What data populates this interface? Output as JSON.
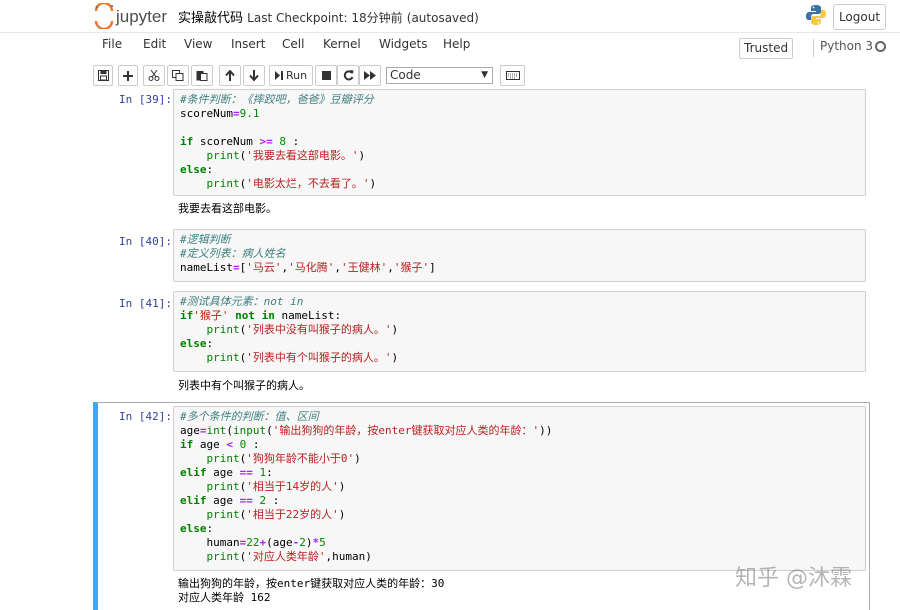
{
  "header": {
    "logo_text": "jupyter",
    "notebook_name": "实操敲代码",
    "checkpoint": "Last Checkpoint: 18分钟前",
    "autosave": "(autosaved)",
    "logout_label": "Logout"
  },
  "menu": {
    "items": [
      "File",
      "Edit",
      "View",
      "Insert",
      "Cell",
      "Kernel",
      "Widgets",
      "Help"
    ],
    "trusted_label": "Trusted",
    "kernel_name": "Python 3"
  },
  "toolbar": {
    "run_label": "Run",
    "cell_type": "Code"
  },
  "cells": [
    {
      "prompt": "In [39]:",
      "lines": [
        [
          [
            "cm-comment",
            "#条件判断：《摔跤吧，爸爸》豆瓣评分"
          ]
        ],
        [
          [
            "",
            "scoreNum"
          ],
          [
            "cm-operator",
            "="
          ],
          [
            "cm-number",
            "9.1"
          ]
        ],
        [
          [
            "",
            ""
          ]
        ],
        [
          [
            "cm-keyword",
            "if"
          ],
          [
            "",
            " scoreNum "
          ],
          [
            "cm-operator",
            ">="
          ],
          [
            "",
            " "
          ],
          [
            "cm-number",
            "8"
          ],
          [
            "",
            " :"
          ]
        ],
        [
          [
            "",
            "    "
          ],
          [
            "cm-builtin",
            "print"
          ],
          [
            "",
            "("
          ],
          [
            "cm-string",
            "'我要去看这部电影。'"
          ],
          [
            "",
            ")"
          ]
        ],
        [
          [
            "cm-keyword",
            "else"
          ],
          [
            "",
            ":"
          ]
        ],
        [
          [
            "",
            "    "
          ],
          [
            "cm-builtin",
            "print"
          ],
          [
            "",
            "("
          ],
          [
            "cm-string",
            "'电影太烂，不去看了。'"
          ],
          [
            "",
            ")"
          ]
        ]
      ],
      "output": [
        "我要去看这部电影。"
      ]
    },
    {
      "prompt": "In [40]:",
      "lines": [
        [
          [
            "cm-comment",
            "#逻辑判断"
          ]
        ],
        [
          [
            "cm-comment",
            "#定义列表：病人姓名"
          ]
        ],
        [
          [
            "",
            "nameList"
          ],
          [
            "cm-operator",
            "="
          ],
          [
            "",
            "["
          ],
          [
            "cm-string",
            "'马云'"
          ],
          [
            "",
            ","
          ],
          [
            "cm-string",
            "'马化腾'"
          ],
          [
            "",
            ","
          ],
          [
            "cm-string",
            "'王健林'"
          ],
          [
            "",
            ","
          ],
          [
            "cm-string",
            "'猴子'"
          ],
          [
            "",
            "]"
          ]
        ]
      ],
      "output": []
    },
    {
      "prompt": "In [41]:",
      "lines": [
        [
          [
            "cm-comment",
            "#测试具体元素：not in"
          ]
        ],
        [
          [
            "cm-keyword",
            "if"
          ],
          [
            "cm-string",
            "'猴子'"
          ],
          [
            "",
            " "
          ],
          [
            "cm-keyword",
            "not"
          ],
          [
            "",
            " "
          ],
          [
            "cm-keyword",
            "in"
          ],
          [
            "",
            " nameList:"
          ]
        ],
        [
          [
            "",
            "    "
          ],
          [
            "cm-builtin",
            "print"
          ],
          [
            "",
            "("
          ],
          [
            "cm-string",
            "'列表中没有叫猴子的病人。'"
          ],
          [
            "",
            ")"
          ]
        ],
        [
          [
            "cm-keyword",
            "else"
          ],
          [
            "",
            ":"
          ]
        ],
        [
          [
            "",
            "    "
          ],
          [
            "cm-builtin",
            "print"
          ],
          [
            "",
            "("
          ],
          [
            "cm-string",
            "'列表中有个叫猴子的病人。'"
          ],
          [
            "",
            ")"
          ]
        ]
      ],
      "output": [
        "列表中有个叫猴子的病人。"
      ]
    },
    {
      "prompt": "In [42]:",
      "lines": [
        [
          [
            "cm-comment",
            "#多个条件的判断：值、区间"
          ]
        ],
        [
          [
            "",
            "age"
          ],
          [
            "cm-operator",
            "="
          ],
          [
            "cm-builtin",
            "int"
          ],
          [
            "",
            "("
          ],
          [
            "cm-builtin",
            "input"
          ],
          [
            "",
            "("
          ],
          [
            "cm-string",
            "'输出狗狗的年龄，按enter键获取对应人类的年龄：'"
          ],
          [
            "",
            "))"
          ]
        ],
        [
          [
            "cm-keyword",
            "if"
          ],
          [
            "",
            " age "
          ],
          [
            "cm-operator",
            "<"
          ],
          [
            "",
            " "
          ],
          [
            "cm-number",
            "0"
          ],
          [
            "",
            " :"
          ]
        ],
        [
          [
            "",
            "    "
          ],
          [
            "cm-builtin",
            "print"
          ],
          [
            "",
            "("
          ],
          [
            "cm-string",
            "'狗狗年龄不能小于0'"
          ],
          [
            "",
            ")"
          ]
        ],
        [
          [
            "cm-keyword",
            "elif"
          ],
          [
            "",
            " age "
          ],
          [
            "cm-operator",
            "=="
          ],
          [
            "",
            " "
          ],
          [
            "cm-number",
            "1"
          ],
          [
            "",
            ":"
          ]
        ],
        [
          [
            "",
            "    "
          ],
          [
            "cm-builtin",
            "print"
          ],
          [
            "",
            "("
          ],
          [
            "cm-string",
            "'相当于14岁的人'"
          ],
          [
            "",
            ")"
          ]
        ],
        [
          [
            "cm-keyword",
            "elif"
          ],
          [
            "",
            " age "
          ],
          [
            "cm-operator",
            "=="
          ],
          [
            "",
            " "
          ],
          [
            "cm-number",
            "2"
          ],
          [
            "",
            " :"
          ]
        ],
        [
          [
            "",
            "    "
          ],
          [
            "cm-builtin",
            "print"
          ],
          [
            "",
            "("
          ],
          [
            "cm-string",
            "'相当于22岁的人'"
          ],
          [
            "",
            ")"
          ]
        ],
        [
          [
            "cm-keyword",
            "else"
          ],
          [
            "",
            ":"
          ]
        ],
        [
          [
            "",
            "    human"
          ],
          [
            "cm-operator",
            "="
          ],
          [
            "cm-number",
            "22"
          ],
          [
            "cm-operator",
            "+"
          ],
          [
            "",
            "(age"
          ],
          [
            "cm-operator",
            "-"
          ],
          [
            "cm-number",
            "2"
          ],
          [
            "",
            ")"
          ],
          [
            "cm-operator",
            "*"
          ],
          [
            "cm-number",
            "5"
          ]
        ],
        [
          [
            "",
            "    "
          ],
          [
            "cm-builtin",
            "print"
          ],
          [
            "",
            "("
          ],
          [
            "cm-string",
            "'对应人类年龄'"
          ],
          [
            "",
            ",human)"
          ]
        ]
      ],
      "output": [
        "输出狗狗的年龄，按enter键获取对应人类的年龄：30",
        "对应人类年龄 162"
      ]
    }
  ],
  "watermark": "知乎 @沐霖"
}
